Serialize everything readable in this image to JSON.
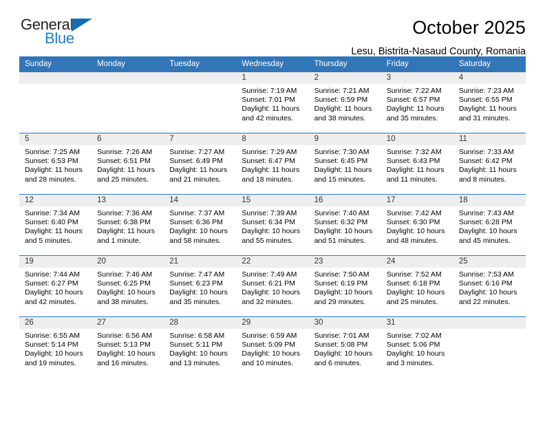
{
  "brand": {
    "name_part1": "General",
    "name_part2": "Blue",
    "accent_color": "#1f7ec4",
    "triangle_color": "#156cb0"
  },
  "header": {
    "title": "October 2025",
    "subtitle": "Lesu, Bistrita-Nasaud County, Romania",
    "header_bg": "#3276b8"
  },
  "weekday_headers": [
    "Sunday",
    "Monday",
    "Tuesday",
    "Wednesday",
    "Thursday",
    "Friday",
    "Saturday"
  ],
  "weeks": [
    [
      {
        "day": "",
        "sunrise": "",
        "sunset": "",
        "daylight1": "",
        "daylight2": "",
        "empty": true
      },
      {
        "day": "",
        "sunrise": "",
        "sunset": "",
        "daylight1": "",
        "daylight2": "",
        "empty": true
      },
      {
        "day": "",
        "sunrise": "",
        "sunset": "",
        "daylight1": "",
        "daylight2": "",
        "empty": true
      },
      {
        "day": "1",
        "sunrise": "Sunrise: 7:19 AM",
        "sunset": "Sunset: 7:01 PM",
        "daylight1": "Daylight: 11 hours",
        "daylight2": "and 42 minutes.",
        "empty": false
      },
      {
        "day": "2",
        "sunrise": "Sunrise: 7:21 AM",
        "sunset": "Sunset: 6:59 PM",
        "daylight1": "Daylight: 11 hours",
        "daylight2": "and 38 minutes.",
        "empty": false
      },
      {
        "day": "3",
        "sunrise": "Sunrise: 7:22 AM",
        "sunset": "Sunset: 6:57 PM",
        "daylight1": "Daylight: 11 hours",
        "daylight2": "and 35 minutes.",
        "empty": false
      },
      {
        "day": "4",
        "sunrise": "Sunrise: 7:23 AM",
        "sunset": "Sunset: 6:55 PM",
        "daylight1": "Daylight: 11 hours",
        "daylight2": "and 31 minutes.",
        "empty": false
      }
    ],
    [
      {
        "day": "5",
        "sunrise": "Sunrise: 7:25 AM",
        "sunset": "Sunset: 6:53 PM",
        "daylight1": "Daylight: 11 hours",
        "daylight2": "and 28 minutes.",
        "empty": false
      },
      {
        "day": "6",
        "sunrise": "Sunrise: 7:26 AM",
        "sunset": "Sunset: 6:51 PM",
        "daylight1": "Daylight: 11 hours",
        "daylight2": "and 25 minutes.",
        "empty": false
      },
      {
        "day": "7",
        "sunrise": "Sunrise: 7:27 AM",
        "sunset": "Sunset: 6:49 PM",
        "daylight1": "Daylight: 11 hours",
        "daylight2": "and 21 minutes.",
        "empty": false
      },
      {
        "day": "8",
        "sunrise": "Sunrise: 7:29 AM",
        "sunset": "Sunset: 6:47 PM",
        "daylight1": "Daylight: 11 hours",
        "daylight2": "and 18 minutes.",
        "empty": false
      },
      {
        "day": "9",
        "sunrise": "Sunrise: 7:30 AM",
        "sunset": "Sunset: 6:45 PM",
        "daylight1": "Daylight: 11 hours",
        "daylight2": "and 15 minutes.",
        "empty": false
      },
      {
        "day": "10",
        "sunrise": "Sunrise: 7:32 AM",
        "sunset": "Sunset: 6:43 PM",
        "daylight1": "Daylight: 11 hours",
        "daylight2": "and 11 minutes.",
        "empty": false
      },
      {
        "day": "11",
        "sunrise": "Sunrise: 7:33 AM",
        "sunset": "Sunset: 6:42 PM",
        "daylight1": "Daylight: 11 hours",
        "daylight2": "and 8 minutes.",
        "empty": false
      }
    ],
    [
      {
        "day": "12",
        "sunrise": "Sunrise: 7:34 AM",
        "sunset": "Sunset: 6:40 PM",
        "daylight1": "Daylight: 11 hours",
        "daylight2": "and 5 minutes.",
        "empty": false
      },
      {
        "day": "13",
        "sunrise": "Sunrise: 7:36 AM",
        "sunset": "Sunset: 6:38 PM",
        "daylight1": "Daylight: 11 hours",
        "daylight2": "and 1 minute.",
        "empty": false
      },
      {
        "day": "14",
        "sunrise": "Sunrise: 7:37 AM",
        "sunset": "Sunset: 6:36 PM",
        "daylight1": "Daylight: 10 hours",
        "daylight2": "and 58 minutes.",
        "empty": false
      },
      {
        "day": "15",
        "sunrise": "Sunrise: 7:39 AM",
        "sunset": "Sunset: 6:34 PM",
        "daylight1": "Daylight: 10 hours",
        "daylight2": "and 55 minutes.",
        "empty": false
      },
      {
        "day": "16",
        "sunrise": "Sunrise: 7:40 AM",
        "sunset": "Sunset: 6:32 PM",
        "daylight1": "Daylight: 10 hours",
        "daylight2": "and 51 minutes.",
        "empty": false
      },
      {
        "day": "17",
        "sunrise": "Sunrise: 7:42 AM",
        "sunset": "Sunset: 6:30 PM",
        "daylight1": "Daylight: 10 hours",
        "daylight2": "and 48 minutes.",
        "empty": false
      },
      {
        "day": "18",
        "sunrise": "Sunrise: 7:43 AM",
        "sunset": "Sunset: 6:28 PM",
        "daylight1": "Daylight: 10 hours",
        "daylight2": "and 45 minutes.",
        "empty": false
      }
    ],
    [
      {
        "day": "19",
        "sunrise": "Sunrise: 7:44 AM",
        "sunset": "Sunset: 6:27 PM",
        "daylight1": "Daylight: 10 hours",
        "daylight2": "and 42 minutes.",
        "empty": false
      },
      {
        "day": "20",
        "sunrise": "Sunrise: 7:46 AM",
        "sunset": "Sunset: 6:25 PM",
        "daylight1": "Daylight: 10 hours",
        "daylight2": "and 38 minutes.",
        "empty": false
      },
      {
        "day": "21",
        "sunrise": "Sunrise: 7:47 AM",
        "sunset": "Sunset: 6:23 PM",
        "daylight1": "Daylight: 10 hours",
        "daylight2": "and 35 minutes.",
        "empty": false
      },
      {
        "day": "22",
        "sunrise": "Sunrise: 7:49 AM",
        "sunset": "Sunset: 6:21 PM",
        "daylight1": "Daylight: 10 hours",
        "daylight2": "and 32 minutes.",
        "empty": false
      },
      {
        "day": "23",
        "sunrise": "Sunrise: 7:50 AM",
        "sunset": "Sunset: 6:19 PM",
        "daylight1": "Daylight: 10 hours",
        "daylight2": "and 29 minutes.",
        "empty": false
      },
      {
        "day": "24",
        "sunrise": "Sunrise: 7:52 AM",
        "sunset": "Sunset: 6:18 PM",
        "daylight1": "Daylight: 10 hours",
        "daylight2": "and 25 minutes.",
        "empty": false
      },
      {
        "day": "25",
        "sunrise": "Sunrise: 7:53 AM",
        "sunset": "Sunset: 6:16 PM",
        "daylight1": "Daylight: 10 hours",
        "daylight2": "and 22 minutes.",
        "empty": false
      }
    ],
    [
      {
        "day": "26",
        "sunrise": "Sunrise: 6:55 AM",
        "sunset": "Sunset: 5:14 PM",
        "daylight1": "Daylight: 10 hours",
        "daylight2": "and 19 minutes.",
        "empty": false
      },
      {
        "day": "27",
        "sunrise": "Sunrise: 6:56 AM",
        "sunset": "Sunset: 5:13 PM",
        "daylight1": "Daylight: 10 hours",
        "daylight2": "and 16 minutes.",
        "empty": false
      },
      {
        "day": "28",
        "sunrise": "Sunrise: 6:58 AM",
        "sunset": "Sunset: 5:11 PM",
        "daylight1": "Daylight: 10 hours",
        "daylight2": "and 13 minutes.",
        "empty": false
      },
      {
        "day": "29",
        "sunrise": "Sunrise: 6:59 AM",
        "sunset": "Sunset: 5:09 PM",
        "daylight1": "Daylight: 10 hours",
        "daylight2": "and 10 minutes.",
        "empty": false
      },
      {
        "day": "30",
        "sunrise": "Sunrise: 7:01 AM",
        "sunset": "Sunset: 5:08 PM",
        "daylight1": "Daylight: 10 hours",
        "daylight2": "and 6 minutes.",
        "empty": false
      },
      {
        "day": "31",
        "sunrise": "Sunrise: 7:02 AM",
        "sunset": "Sunset: 5:06 PM",
        "daylight1": "Daylight: 10 hours",
        "daylight2": "and 3 minutes.",
        "empty": false
      },
      {
        "day": "",
        "sunrise": "",
        "sunset": "",
        "daylight1": "",
        "daylight2": "",
        "empty": true
      }
    ]
  ]
}
